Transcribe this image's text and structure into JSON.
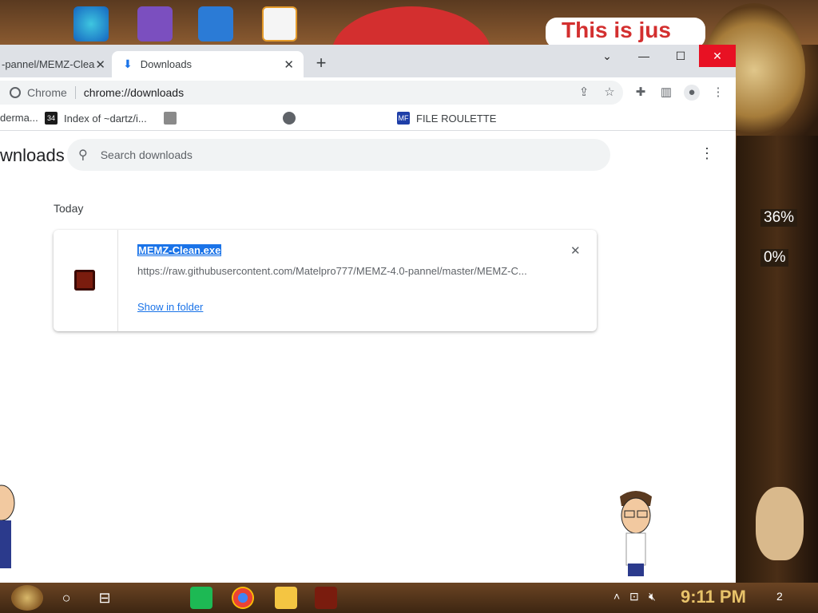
{
  "browser": {
    "tabs": [
      {
        "label": "-pannel/MEMZ-Clea"
      },
      {
        "label": "Downloads"
      }
    ],
    "omnibox": {
      "site": "Chrome",
      "url": "chrome://downloads"
    },
    "bookmarks": [
      {
        "label": "derma..."
      },
      {
        "label": "Index of ~dartz/i...",
        "fav_text": "34"
      },
      {
        "label": ""
      },
      {
        "label": ""
      },
      {
        "label": "FILE ROULETTE",
        "fav_text": "MF"
      }
    ]
  },
  "downloads": {
    "title": "wnloads",
    "search_placeholder": "Search downloads",
    "section": "Today",
    "item": {
      "file_name": "MEMZ-Clean.exe",
      "url": "https://raw.githubusercontent.com/Matelpro777/MEMZ-4.0-pannel/master/MEMZ-C...",
      "show_in_folder": "Show in folder"
    }
  },
  "desktop": {
    "banner_text": "This is jus",
    "pct_1": "36%",
    "pct_2": "0%"
  },
  "taskbar": {
    "time": "9:11 PM",
    "notifications": "2"
  },
  "colors": {
    "accent": "#1a73e8",
    "close_red": "#e81123",
    "tab_bar": "#dee1e6"
  }
}
